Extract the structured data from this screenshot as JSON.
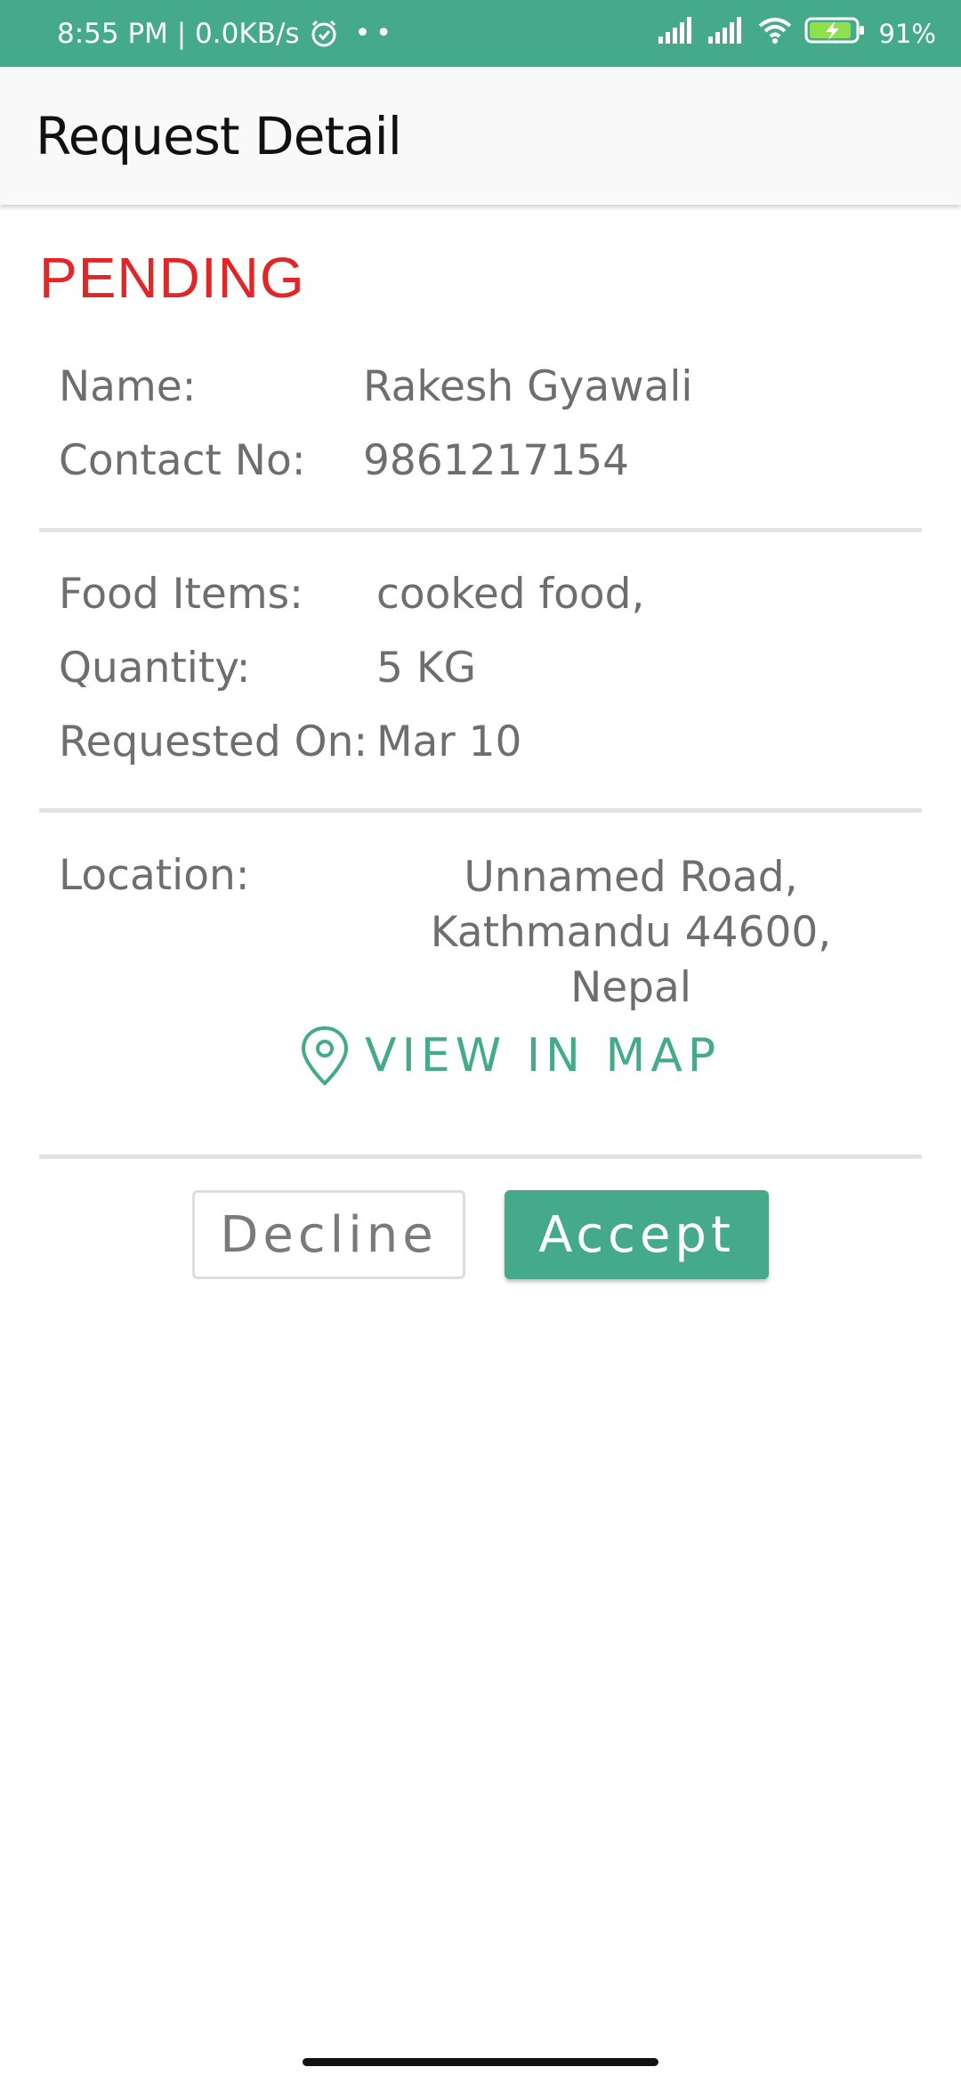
{
  "status_bar": {
    "time_speed": "8:55 PM | 0.0KB/s",
    "dots": "••",
    "battery": "91%",
    "icons": [
      "alarm-icon",
      "signal-icon",
      "signal-icon",
      "wifi-icon",
      "battery-charging-icon"
    ]
  },
  "app_bar": {
    "title": "Request Detail"
  },
  "request": {
    "status": "PENDING",
    "name_label": "Name:",
    "name_value": "Rakesh Gyawali",
    "contact_label": "Contact No:",
    "contact_value": "9861217154",
    "food_label": "Food Items:",
    "food_value": "cooked food,",
    "quantity_label": "Quantity:",
    "quantity_value": "5 KG",
    "requested_label": "Requested On:",
    "requested_value": "Mar 10",
    "location_label": "Location:",
    "location_line1": "Unnamed Road,",
    "location_line2": "Kathmandu 44600, Nepal"
  },
  "actions": {
    "map_label": "VIEW IN MAP",
    "decline_label": "Decline",
    "accept_label": "Accept"
  },
  "colors": {
    "accent": "#45aa89",
    "status_pending": "#e02626",
    "text": "#6e6e6e"
  }
}
